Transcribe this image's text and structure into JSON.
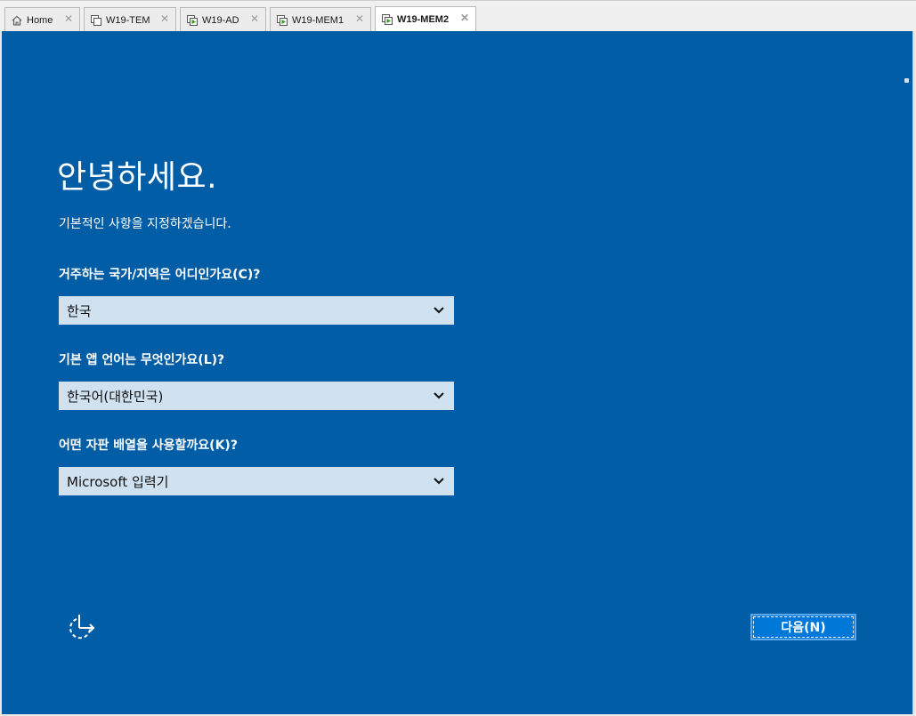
{
  "tabs": [
    {
      "label": "Home",
      "icon": "home-icon",
      "active": false
    },
    {
      "label": "W19-TEM",
      "icon": "vm-template-icon",
      "active": false
    },
    {
      "label": "W19-AD",
      "icon": "vm-running-icon",
      "active": false
    },
    {
      "label": "W19-MEM1",
      "icon": "vm-running-icon",
      "active": false
    },
    {
      "label": "W19-MEM2",
      "icon": "vm-running-icon",
      "active": true
    }
  ],
  "setup": {
    "title": "안녕하세요.",
    "subtitle": "기본적인 사항을 지정하겠습니다.",
    "region": {
      "question": "거주하는 국가/지역은 어디인가요(C)?",
      "value": "한국"
    },
    "language": {
      "question": "기본 앱 언어는 무엇인가요(L)?",
      "value": "한국어(대한민국)"
    },
    "keyboard": {
      "question": "어떤 자판 배열을 사용할까요(K)?",
      "value": "Microsoft 입력기"
    },
    "next_label": "다음(N)"
  },
  "colors": {
    "background": "#005da6",
    "dropdown": "#d0e1f0",
    "button": "#0078d7"
  }
}
